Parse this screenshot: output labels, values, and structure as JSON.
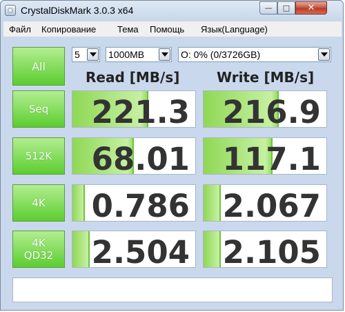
{
  "window": {
    "title": "CrystalDiskMark 3.0.3 x64",
    "min_glyph": "—",
    "max_glyph": "□",
    "close_glyph": "✕"
  },
  "menu": {
    "items": [
      "Файл",
      "Копирование",
      "Тема",
      "Помощь",
      "Язык(Language)"
    ]
  },
  "controls": {
    "all_label": "All",
    "count_value": "5",
    "size_value": "1000MB",
    "drive_value": "O: 0% (0/3726GB)"
  },
  "headers": {
    "read": "Read [MB/s]",
    "write": "Write [MB/s]"
  },
  "rows": [
    {
      "label_line1": "Seq",
      "label_line2": "",
      "read": "221.3",
      "read_fill": 0.62,
      "write": "216.9",
      "write_fill": 0.61
    },
    {
      "label_line1": "512K",
      "label_line2": "",
      "read": "68.01",
      "read_fill": 0.5,
      "write": "117.1",
      "write_fill": 0.56
    },
    {
      "label_line1": "4K",
      "label_line2": "",
      "read": "0.786",
      "read_fill": 0.1,
      "write": "2.067",
      "write_fill": 0.14
    },
    {
      "label_line1": "4K",
      "label_line2": "QD32",
      "read": "2.504",
      "read_fill": 0.14,
      "write": "2.105",
      "write_fill": 0.14
    }
  ],
  "status": {
    "text": ""
  },
  "colors": {
    "button_green": "#5ccd30",
    "bar_green": "#8fd856"
  }
}
